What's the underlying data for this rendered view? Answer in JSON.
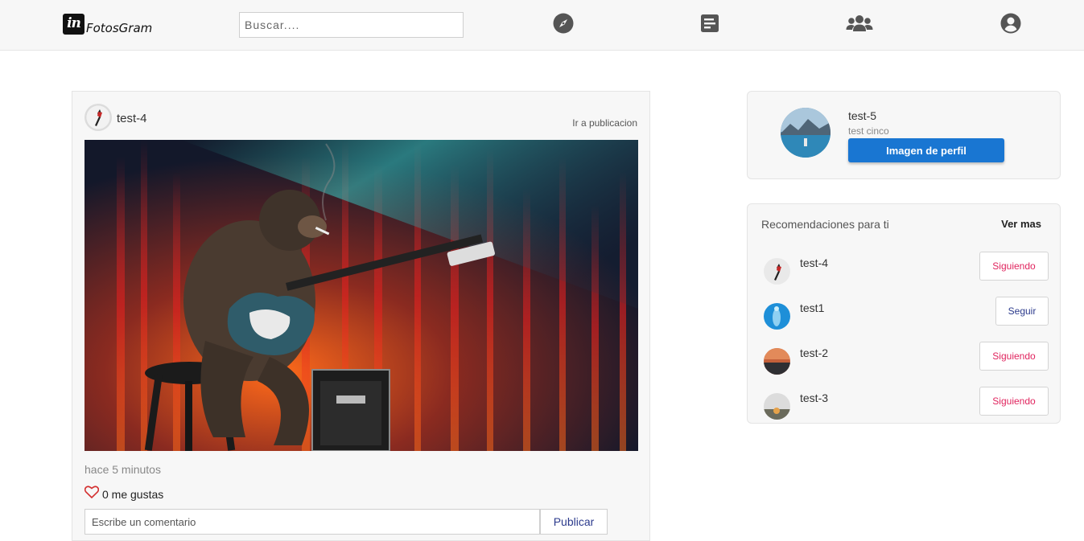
{
  "navbar": {
    "brand_mark": "in",
    "brand_name": "FotosGram",
    "search_placeholder": "Buscar....",
    "icons": [
      "compass-icon",
      "feed-icon",
      "users-icon",
      "account-icon"
    ]
  },
  "post": {
    "username": "test-4",
    "goto_link": "Ir a publicacion",
    "image_description": "monkey-guitar-photo",
    "time_ago": "hace 5 minutos",
    "likes": "0 me gustas",
    "comment_placeholder": "Escribe un comentario",
    "publish_label": "Publicar"
  },
  "profile": {
    "name": "test-5",
    "subtitle": "test cinco",
    "button_label": "Imagen de perfil"
  },
  "recommendations": {
    "title": "Recomendaciones para ti",
    "more_label": "Ver mas",
    "items": [
      {
        "name": "test-4",
        "action": "Siguiendo"
      },
      {
        "name": "test1",
        "action": "Seguir"
      },
      {
        "name": "test-2",
        "action": "Siguiendo"
      },
      {
        "name": "test-3",
        "action": "Siguiendo"
      }
    ]
  },
  "colors": {
    "primary": "#1976d2",
    "following": "#e0245e",
    "follow": "#2b3a8c",
    "heart": "#d32f2f"
  }
}
